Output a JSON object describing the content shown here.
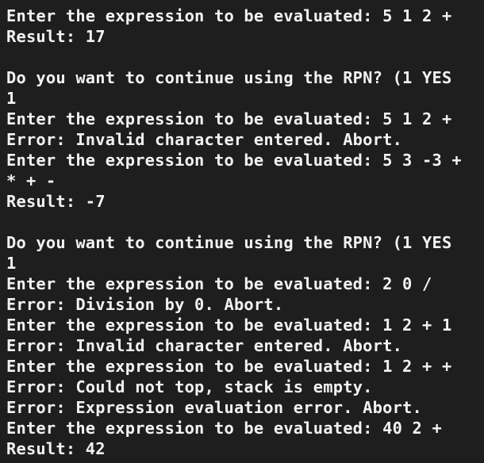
{
  "terminal": {
    "lines": [
      "Enter the expression to be evaluated: 5 1 2 +",
      "Result: 17",
      "",
      "Do you want to continue using the RPN? (1 YES",
      "1",
      "Enter the expression to be evaluated: 5 1 2 +",
      "Error: Invalid character entered. Abort.",
      "Enter the expression to be evaluated: 5 3 -3 +",
      "* + -",
      "Result: -7",
      "",
      "Do you want to continue using the RPN? (1 YES",
      "1",
      "Enter the expression to be evaluated: 2 0 /",
      "Error: Division by 0. Abort.",
      "Enter the expression to be evaluated: 1 2 + 1",
      "Error: Invalid character entered. Abort.",
      "Enter the expression to be evaluated: 1 2 + +",
      "Error: Could not top, stack is empty.",
      "Error: Expression evaluation error. Abort.",
      "Enter the expression to be evaluated: 40 2 +",
      "Result: 42"
    ]
  }
}
